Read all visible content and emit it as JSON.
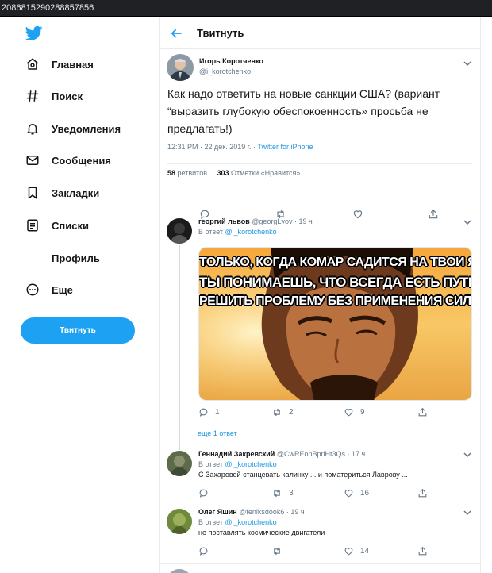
{
  "browser": {
    "url_fragment": "2086815290288857856"
  },
  "sidebar": {
    "items": [
      {
        "label": "Главная",
        "icon": "home-icon"
      },
      {
        "label": "Поиск",
        "icon": "hashtag-icon"
      },
      {
        "label": "Уведомления",
        "icon": "bell-icon"
      },
      {
        "label": "Сообщения",
        "icon": "envelope-icon"
      },
      {
        "label": "Закладки",
        "icon": "bookmark-icon"
      },
      {
        "label": "Списки",
        "icon": "list-icon"
      },
      {
        "label": "Профиль",
        "icon": ""
      },
      {
        "label": "Еще",
        "icon": "more-circle-icon"
      }
    ],
    "tweet_button": "Твитнуть"
  },
  "header": {
    "title": "Твитнуть"
  },
  "tweet": {
    "author_name": "Игорь Коротченко",
    "author_handle": "@i_korotchenko",
    "text": "Как надо ответить на новые санкции США? (вариант “выразить глубокую обеспокоенность» просьба не предлагать!)",
    "time": "12:31 PM · 22 дек. 2019 г. · ",
    "source": "Twitter for iPhone",
    "retweets_count": "58",
    "retweets_label": "ретвитов",
    "likes_count": "303",
    "likes_label": "Отметки «Нравится»"
  },
  "replies": [
    {
      "name": "георгий львов",
      "handle": "@georgLvov",
      "time": "· 19 ч",
      "in_reply_prefix": "В ответ",
      "in_reply_to": "@i_korotchenko",
      "text": "",
      "reply_count": "1",
      "retweet_count": "2",
      "like_count": "9",
      "image_text": [
        "ТОЛЬКО, КОГДА КОМАР САДИТСЯ НА ТВОИ ЯЙЦА",
        "ТЫ ПОНИМАЕШЬ, ЧТО ВСЕГДА ЕСТЬ ПУТЬ",
        "РЕШИТЬ ПРОБЛЕМУ БЕЗ ПРИМЕНЕНИЯ СИЛЫ"
      ],
      "more_replies": "еще 1 ответ"
    },
    {
      "name": "Геннадий Закревский",
      "handle": "@CwREonBprlHt3Qs",
      "time": "· 17 ч",
      "in_reply_prefix": "В ответ",
      "in_reply_to": "@i_korotchenko",
      "text": "С Захаровой станцевать калинку ... и поматериться Лаврову ...",
      "reply_count": "",
      "retweet_count": "3",
      "like_count": "16"
    },
    {
      "name": "Олег Яшин",
      "handle": "@feniksdook6",
      "time": "· 19 ч",
      "in_reply_prefix": "В ответ",
      "in_reply_to": "@i_korotchenko",
      "text": "не поставлять космические двигатели",
      "reply_count": "",
      "retweet_count": "",
      "like_count": "14"
    }
  ],
  "colors": {
    "accent": "#1da1f2",
    "link": "#1b95e0",
    "muted": "#657786",
    "border": "#e6ecf0"
  }
}
